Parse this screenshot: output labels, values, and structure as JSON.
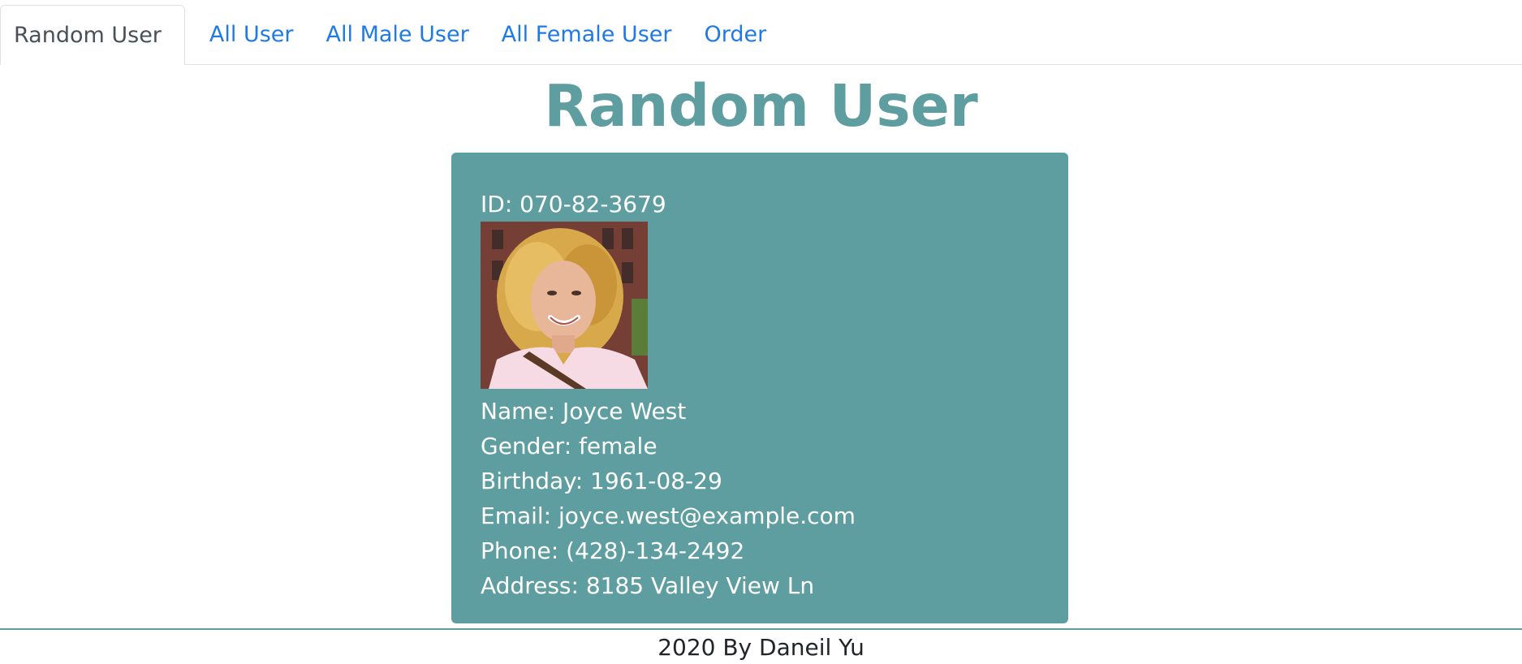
{
  "tabs": [
    {
      "label": "Random User",
      "active": true
    },
    {
      "label": "All User",
      "active": false
    },
    {
      "label": "All Male User",
      "active": false
    },
    {
      "label": "All Female User",
      "active": false
    },
    {
      "label": "Order",
      "active": false
    }
  ],
  "page_title": "Random User",
  "card": {
    "id_label": "ID:",
    "id_value": "070-82-3679",
    "photo_icon": "user-photo",
    "fields": [
      {
        "label": "Name:",
        "value": "Joyce West"
      },
      {
        "label": "Gender:",
        "value": "female"
      },
      {
        "label": "Birthday:",
        "value": "1961-08-29"
      },
      {
        "label": "Email:",
        "value": "joyce.west@example.com"
      },
      {
        "label": "Phone:",
        "value": "(428)-134-2492"
      },
      {
        "label": "Address:",
        "value": "8185 Valley View Ln"
      }
    ]
  },
  "footer": {
    "text": "2020 By Daneil Yu"
  },
  "colors": {
    "accent": "#5f9ea0",
    "link": "#1e7ae6",
    "active_tab_text": "#495057"
  }
}
